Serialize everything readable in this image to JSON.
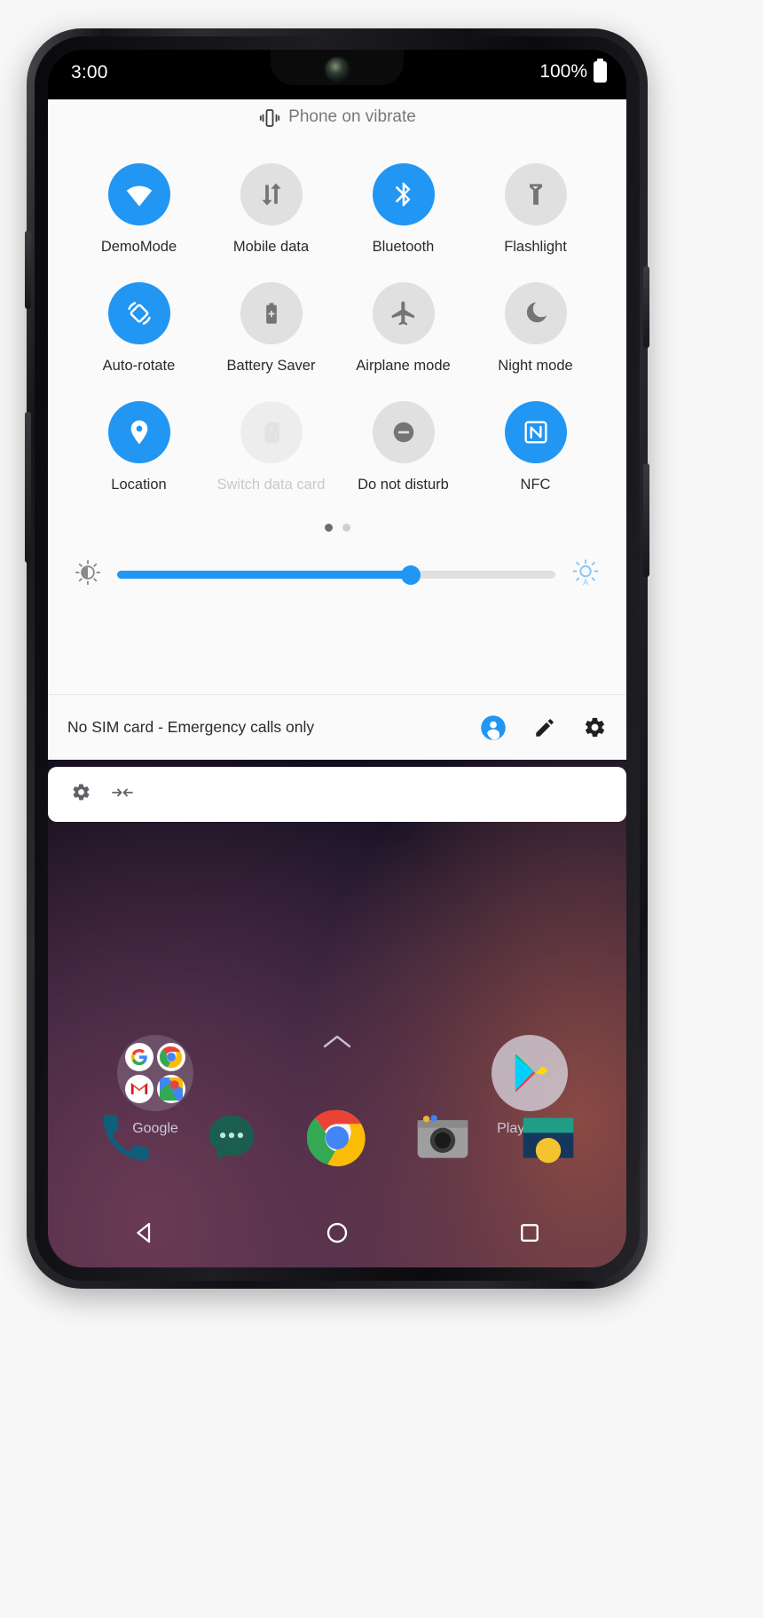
{
  "status_bar": {
    "time": "3:00",
    "battery_percent": "100%",
    "battery_icon": "battery-full-icon"
  },
  "quick_settings": {
    "header_label": "Phone on vibrate",
    "header_icon": "vibrate-icon",
    "tiles": [
      {
        "label": "DemoMode",
        "icon": "wifi-icon",
        "state": "on"
      },
      {
        "label": "Mobile data",
        "icon": "mobile-data-icon",
        "state": "off"
      },
      {
        "label": "Bluetooth",
        "icon": "bluetooth-icon",
        "state": "on"
      },
      {
        "label": "Flashlight",
        "icon": "flashlight-icon",
        "state": "off"
      },
      {
        "label": "Auto-rotate",
        "icon": "auto-rotate-icon",
        "state": "on"
      },
      {
        "label": "Battery Saver",
        "icon": "battery-saver-icon",
        "state": "off"
      },
      {
        "label": "Airplane mode",
        "icon": "airplane-icon",
        "state": "off"
      },
      {
        "label": "Night mode",
        "icon": "moon-icon",
        "state": "off"
      },
      {
        "label": "Location",
        "icon": "location-pin-icon",
        "state": "on"
      },
      {
        "label": "Switch data card",
        "icon": "sim-card-icon",
        "state": "disabled"
      },
      {
        "label": "Do not disturb",
        "icon": "do-not-disturb-icon",
        "state": "off"
      },
      {
        "label": "NFC",
        "icon": "nfc-icon",
        "state": "on"
      }
    ],
    "pages": {
      "count": 2,
      "active_index": 0
    },
    "brightness": {
      "value_percent": 67,
      "low_icon": "brightness-low-icon",
      "auto_icon": "brightness-auto-icon"
    },
    "footer": {
      "status_text": "No SIM card - Emergency calls only",
      "user_icon": "user-account-icon",
      "edit_icon": "pencil-edit-icon",
      "settings_icon": "gear-settings-icon"
    },
    "accent_color": "#2196f3",
    "tile_off_color": "#e0e0e0",
    "panel_background": "#fafafa"
  },
  "notification_card": {
    "settings_icon": "gear-settings-icon",
    "collapse_icon": "collapse-arrows-icon"
  },
  "home_screen": {
    "apps": [
      {
        "label": "Google",
        "icon": "google-folder-icon"
      },
      {
        "label": "Play Store",
        "icon": "play-store-icon"
      }
    ],
    "app_drawer_handle_icon": "chevron-up-icon",
    "dock": [
      {
        "icon": "phone-icon",
        "label": "Phone"
      },
      {
        "icon": "messages-icon",
        "label": "Messages"
      },
      {
        "icon": "chrome-icon",
        "label": "Chrome"
      },
      {
        "icon": "camera-icon",
        "label": "Camera"
      },
      {
        "icon": "photos-icon",
        "label": "Photos"
      }
    ],
    "nav_bar": [
      {
        "icon": "back-triangle-icon",
        "label": "Back"
      },
      {
        "icon": "home-circle-icon",
        "label": "Home"
      },
      {
        "icon": "recents-square-icon",
        "label": "Recents"
      }
    ]
  }
}
